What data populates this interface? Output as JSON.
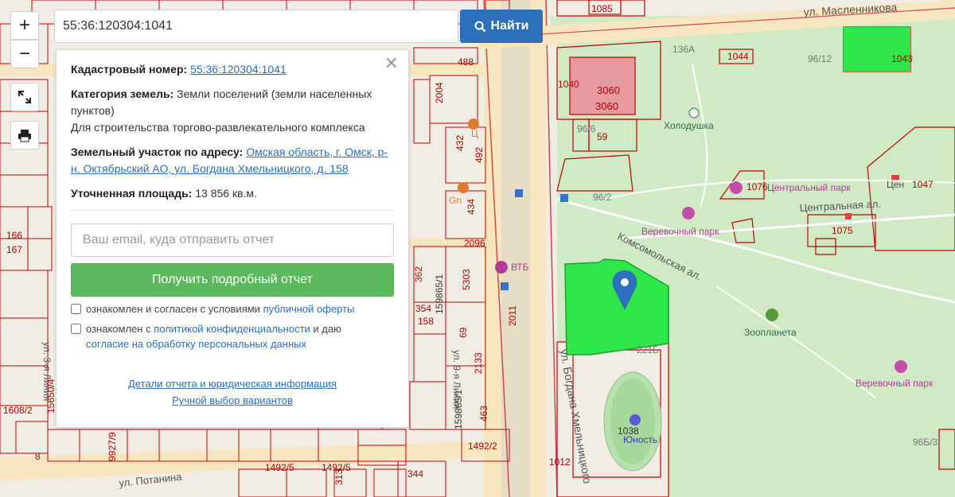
{
  "controls": {
    "zoom_in": "+",
    "zoom_out": "−"
  },
  "search": {
    "value": "55:36:120304:1041",
    "button_label": "Найти"
  },
  "panel": {
    "cadastral_label": "Кадастровый номер:",
    "cadastral_value": "55:36:120304:1041",
    "category_label": "Категория земель:",
    "category_value": "Земли поселений (земли населенных пунктов)",
    "purpose": "Для строительства торгово-развлекательного комплекса",
    "address_label": "Земельный участок по адресу:",
    "address_value": "Омская область, г. Омск, р-н. Октябрьский АО, ул. Богдана Хмельницкого, д. 158",
    "area_label": "Уточненная площадь:",
    "area_value": "13 856 кв.м.",
    "email_placeholder": "Ваш email, куда отправить отчет",
    "report_button": "Получить подробный отчет",
    "consent1_text": "ознакомлен и согласен с условиями",
    "consent1_link": "публичной оферты",
    "consent2_text": "ознакомлен с",
    "consent2_link": "политикой конфиденциальности",
    "consent2_text2": "и даю",
    "consent2_link2": "согласие на обработку персональных данных",
    "details_link": "Детали отчета и юридическая информация",
    "manual_link": "Ручной выбор вариантов"
  },
  "map": {
    "streets": [
      "ул. Масленникова",
      "ул. Богдана Хмельницкого",
      "Комсомольская ал.",
      "Центральная ал.",
      "ул. Потанина",
      "ул. 9-я Линия",
      "ул. 3-я Линия"
    ],
    "pois": [
      "Холодушка",
      "Веревочный парк",
      "Зоопланета",
      "Юность",
      "ВТБ",
      "Gn",
      "Ц",
      "Центральный парк",
      "Цен"
    ],
    "parcels": [
      "1085",
      "1044",
      "1043",
      "136А",
      "96/12",
      "1040",
      "3060",
      "3060",
      "96/6",
      "59",
      "96/2",
      "1076",
      "1047",
      "1075",
      "488",
      "2004",
      "432",
      "492",
      "434",
      "2096",
      "5303",
      "362",
      "354",
      "158",
      "2133",
      "69",
      "463",
      "1492/2",
      "1492/5",
      "1038",
      "1012",
      "2011",
      "159865/1",
      "159865/1",
      "1492/5",
      "344",
      "313",
      "1608/2",
      "15650/4",
      "9927/9",
      "8",
      "167",
      "166",
      "96Б/3",
      "221Б"
    ]
  },
  "colors": {
    "accent": "#2c6fba",
    "success": "#5cb85c",
    "parcel_green": "#2ee84a",
    "boundary": "#c40000"
  }
}
